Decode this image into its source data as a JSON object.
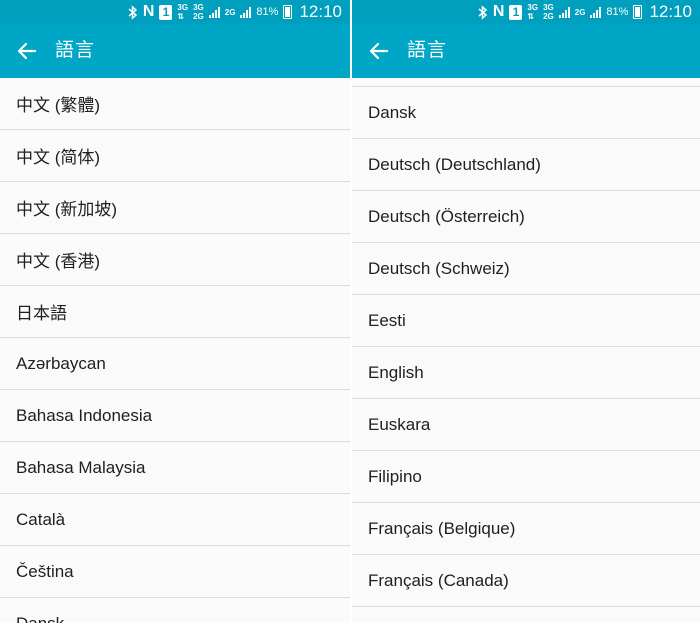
{
  "status_bar": {
    "net_top": "3G",
    "net_bottom": "2G",
    "net_label": "2G",
    "n_label": "N",
    "sim_label": "1",
    "battery_percent": "81%",
    "time": "12:10"
  },
  "app_bar": {
    "title": "語言"
  },
  "left_list": [
    "中文 (繁體)",
    "中文 (简体)",
    "中文 (新加坡)",
    "中文 (香港)",
    "日本語",
    "Azərbaycan",
    "Bahasa Indonesia",
    "Bahasa Malaysia",
    "Català",
    "Čeština",
    "Dansk"
  ],
  "right_list": [
    "Dansk",
    "Deutsch (Deutschland)",
    "Deutsch (Österreich)",
    "Deutsch (Schweiz)",
    "Eesti",
    "English",
    "Euskara",
    "Filipino",
    "Français (Belgique)",
    "Français (Canada)"
  ],
  "colors": {
    "status_bar": "#009fbd",
    "app_bar": "#00a6c6",
    "list_background": "#fafafa",
    "divider": "#dcdcdc",
    "text": "#1f1f1f"
  }
}
